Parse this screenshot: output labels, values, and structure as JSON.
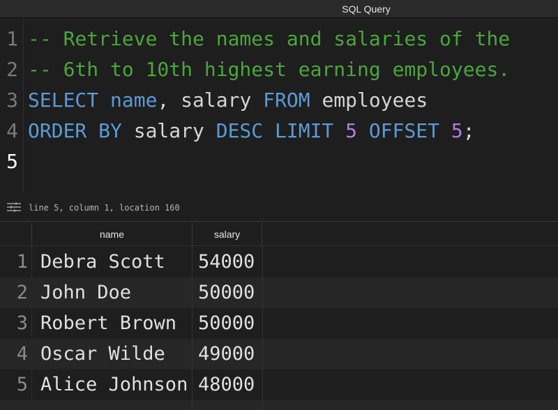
{
  "window": {
    "title": "SQL Query"
  },
  "editor": {
    "lines": [
      {
        "num": "1",
        "tokens": [
          {
            "t": "-- Retrieve the names and salaries of the",
            "c": "cm"
          }
        ]
      },
      {
        "num": "2",
        "tokens": [
          {
            "t": "-- 6th to 10th highest earning employees.",
            "c": "cm"
          }
        ]
      },
      {
        "num": "3",
        "tokens": [
          {
            "t": "SELECT",
            "c": "kw"
          },
          {
            "t": " ",
            "c": "id"
          },
          {
            "t": "name",
            "c": "kw"
          },
          {
            "t": ", salary ",
            "c": "id"
          },
          {
            "t": "FROM",
            "c": "kw"
          },
          {
            "t": " employees",
            "c": "id"
          }
        ]
      },
      {
        "num": "4",
        "tokens": [
          {
            "t": "ORDER BY",
            "c": "kw"
          },
          {
            "t": " salary ",
            "c": "id"
          },
          {
            "t": "DESC LIMIT",
            "c": "kw"
          },
          {
            "t": " ",
            "c": "id"
          },
          {
            "t": "5",
            "c": "num"
          },
          {
            "t": " ",
            "c": "id"
          },
          {
            "t": "OFFSET",
            "c": "kw"
          },
          {
            "t": " ",
            "c": "id"
          },
          {
            "t": "5",
            "c": "num"
          },
          {
            "t": ";",
            "c": "id"
          }
        ]
      },
      {
        "num": "5",
        "tokens": []
      }
    ],
    "active_line": "5"
  },
  "status": {
    "text": "line 5, column 1, location 160",
    "icon": "settings-sliders-icon"
  },
  "results": {
    "columns": [
      "name",
      "salary"
    ],
    "rows": [
      {
        "num": "1",
        "name": "Debra Scott",
        "salary": "54000"
      },
      {
        "num": "2",
        "name": "John Doe",
        "salary": "50000"
      },
      {
        "num": "3",
        "name": "Robert Brown",
        "salary": "50000"
      },
      {
        "num": "4",
        "name": "Oscar Wilde",
        "salary": "49000"
      },
      {
        "num": "5",
        "name": "Alice Johnson",
        "salary": "48000"
      }
    ]
  },
  "colors": {
    "comment": "#4aa63a",
    "keyword": "#5b9bd8",
    "number": "#b07ee0",
    "background": "#1e1e1e"
  }
}
